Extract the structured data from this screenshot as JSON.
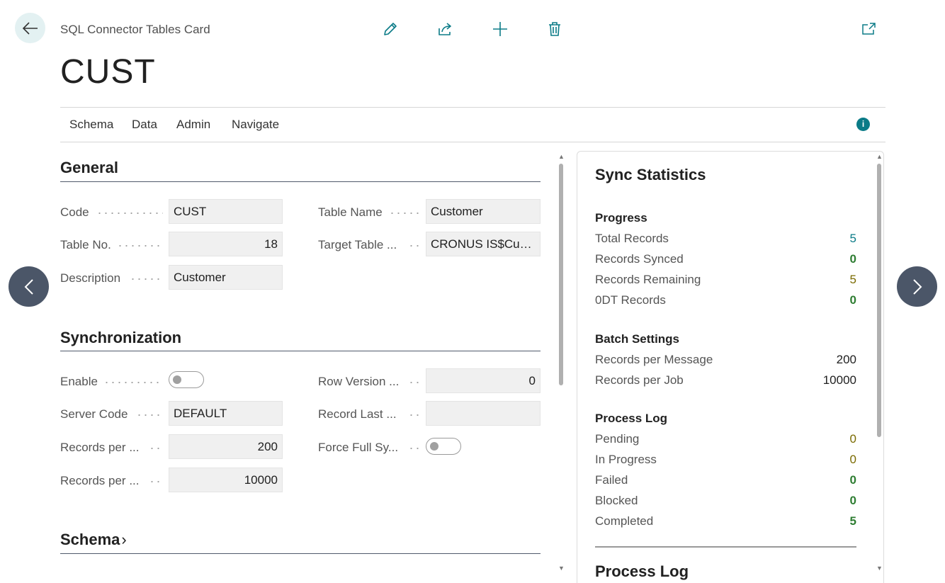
{
  "header": {
    "caption": "SQL Connector Tables Card",
    "title": "CUST",
    "icons": [
      "back-arrow-icon",
      "edit-pencil-icon",
      "share-icon",
      "new-plus-icon",
      "delete-trash-icon",
      "open-new-window-icon"
    ]
  },
  "menu": {
    "items": [
      "Schema",
      "Data",
      "Admin",
      "Navigate"
    ],
    "info": "i"
  },
  "general": {
    "title": "General",
    "code": {
      "label": "Code",
      "value": "CUST"
    },
    "table_name": {
      "label": "Table Name",
      "value": "Customer"
    },
    "table_no": {
      "label": "Table No.",
      "value": "18"
    },
    "target_table": {
      "label": "Target Table ...",
      "value": "CRONUS IS$Cust..."
    },
    "description": {
      "label": "Description",
      "value": "Customer"
    }
  },
  "sync": {
    "title": "Synchronization",
    "enable": {
      "label": "Enable",
      "on": false
    },
    "row_version": {
      "label": "Row Version ...",
      "value": "0"
    },
    "server_code": {
      "label": "Server Code",
      "value": "DEFAULT"
    },
    "record_last": {
      "label": "Record Last ...",
      "value": ""
    },
    "records_per_1": {
      "label": "Records per ...",
      "value": "200"
    },
    "force_full": {
      "label": "Force Full Sy...",
      "on": false
    },
    "records_per_2": {
      "label": "Records per ...",
      "value": "10000"
    }
  },
  "schema": {
    "title": "Schema",
    "chevron": "›"
  },
  "factbox": {
    "title": "Sync Statistics",
    "progress": {
      "title": "Progress",
      "rows": [
        {
          "label": "Total Records",
          "value": "5",
          "color": "#0b7b87"
        },
        {
          "label": "Records Synced",
          "value": "0",
          "color": "#2e7d32"
        },
        {
          "label": "Records Remaining",
          "value": "5",
          "color": "#7a6a00"
        },
        {
          "label": "0DT Records",
          "value": "0",
          "color": "#2e7d32"
        }
      ]
    },
    "batch": {
      "title": "Batch Settings",
      "rows": [
        {
          "label": "Records per Message",
          "value": "200"
        },
        {
          "label": "Records per Job",
          "value": "10000"
        }
      ]
    },
    "log": {
      "title": "Process Log",
      "rows": [
        {
          "label": "Pending",
          "value": "0",
          "color": "#7a6a00"
        },
        {
          "label": "In Progress",
          "value": "0",
          "color": "#7a6a00"
        },
        {
          "label": "Failed",
          "value": "0",
          "color": "#2e7d32"
        },
        {
          "label": "Blocked",
          "value": "0",
          "color": "#2e7d32"
        },
        {
          "label": "Completed",
          "value": "5",
          "color": "#2e7d32"
        }
      ]
    },
    "next_title": "Process Log"
  },
  "colors": {
    "accent": "#0b7b87",
    "nav": "#4b5668"
  }
}
